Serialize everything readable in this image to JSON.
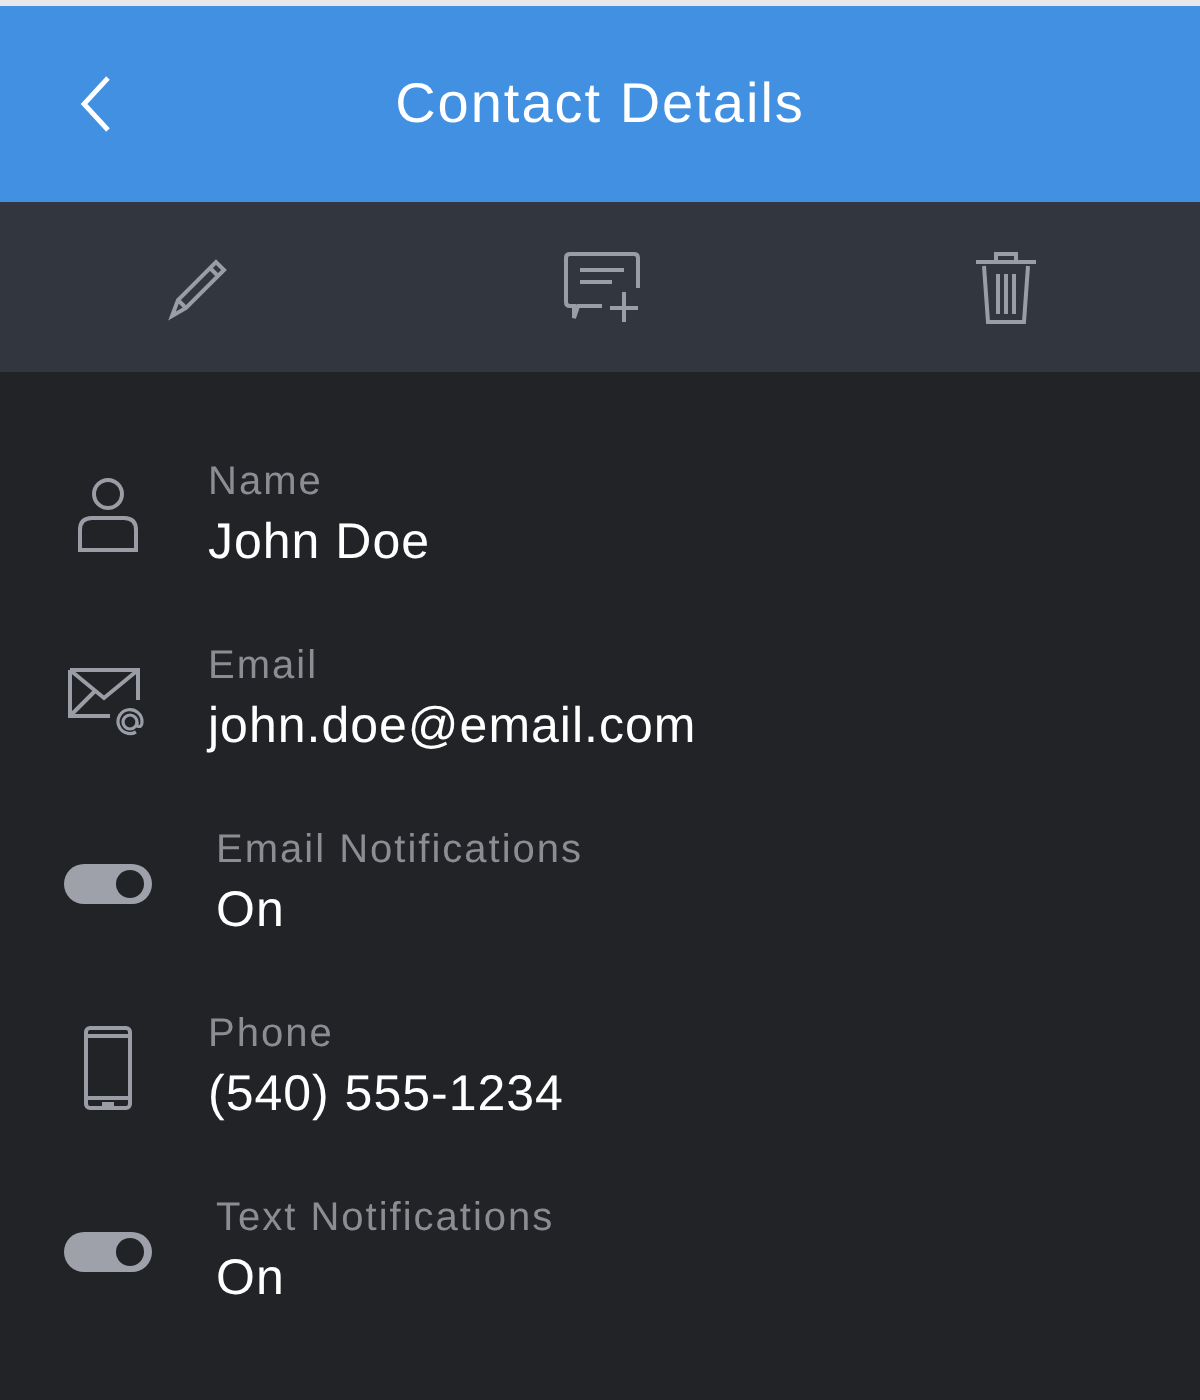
{
  "header": {
    "title": "Contact Details"
  },
  "toolbar": [
    {
      "kind": "edit"
    },
    {
      "kind": "comment-add"
    },
    {
      "kind": "delete"
    }
  ],
  "fields": [
    {
      "kind": "person",
      "label": "Name",
      "value": "John Doe"
    },
    {
      "kind": "email",
      "label": "Email",
      "value": "john.doe@email.com"
    },
    {
      "kind": "toggle",
      "label": "Email Notifications",
      "value": "On",
      "on": true
    },
    {
      "kind": "phone",
      "label": "Phone",
      "value": "(540) 555-1234"
    },
    {
      "kind": "toggle",
      "label": "Text Notifications",
      "value": "On",
      "on": true
    }
  ]
}
